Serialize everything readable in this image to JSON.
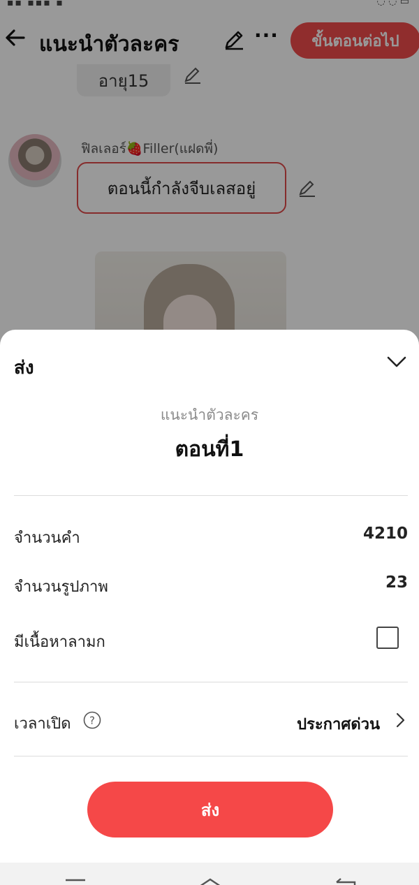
{
  "top_bar": {
    "title": "แนะนำตัวละคร",
    "next_button": "ขั้นตอนต่อไป",
    "more": "···"
  },
  "chat": {
    "age_bubble": "อายุ15",
    "sender_name": "ฟิลเลอร์🍓Filler(แฝดพี่)",
    "message": "ตอนนี้กำลังจีบเลสอยู่"
  },
  "sheet": {
    "title": "ส่ง",
    "subtitle": "แนะนำตัวละคร",
    "episode": "ตอนที่1",
    "word_count_label": "จำนวนคำ",
    "word_count_value": "4210",
    "image_count_label": "จำนวนรูปภาพ",
    "image_count_value": "23",
    "adult_content_label": "มีเนื้อหาลามก",
    "publish_time_label": "เวลาเปิด",
    "help_glyph": "?",
    "publish_time_value": "ประกาศด่วน",
    "send_button": "ส่ง"
  },
  "colors": {
    "accent": "#f54848",
    "overlay": "rgba(0,0,0,0.4)"
  }
}
